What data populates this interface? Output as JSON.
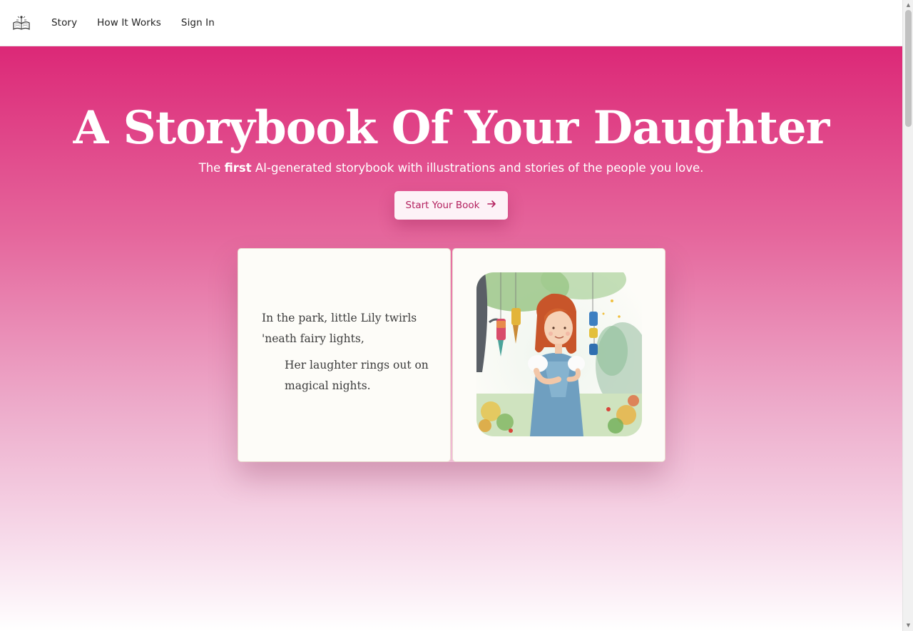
{
  "nav": {
    "logo_icon": "open-book-icon",
    "links": [
      "Story",
      "How It Works",
      "Sign In"
    ]
  },
  "hero": {
    "headline_regular": "A Storybook Of Your ",
    "headline_bold": "Daughter",
    "subtitle_pre": "The ",
    "subtitle_bold": "first",
    "subtitle_post": " AI-generated storybook with illustrations and stories of the people you love.",
    "cta_label": "Start Your Book",
    "cta_icon": "arrow-right-icon",
    "gradient_top": "#dc2877",
    "gradient_bottom": "#ffffff",
    "cta_text_color": "#b3215f"
  },
  "book": {
    "stanza1": "In the park, little Lily twirls 'neath fairy lights,",
    "stanza2": "Her laughter rings out on magical nights.",
    "illustration_icon": "girl-with-fairy-lanterns-illustration"
  }
}
